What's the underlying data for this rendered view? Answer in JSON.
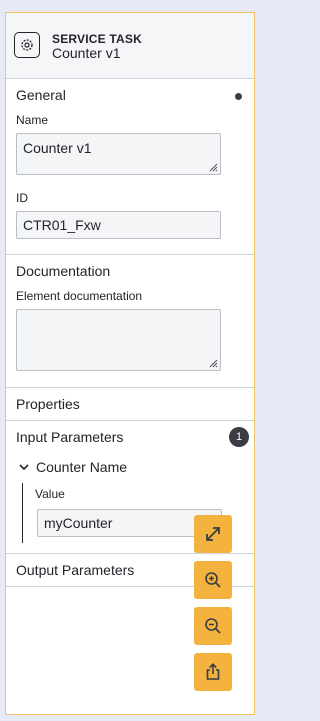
{
  "header": {
    "type": "SERVICE TASK",
    "name": "Counter v1",
    "icon": "gear-icon"
  },
  "general": {
    "title": "General",
    "name_label": "Name",
    "name_value": "Counter v1",
    "id_label": "ID",
    "id_value": "CTR01_Fxw"
  },
  "documentation": {
    "title": "Documentation",
    "label": "Element documentation",
    "value": ""
  },
  "properties": {
    "title": "Properties"
  },
  "input_parameters": {
    "title": "Input Parameters",
    "count": "1",
    "items": [
      {
        "name": "Counter Name",
        "value_label": "Value",
        "value": "myCounter"
      }
    ]
  },
  "output_parameters": {
    "title": "Output Parameters"
  },
  "toolbar": {
    "icons": [
      "expand-icon",
      "zoom-in-icon",
      "zoom-out-icon",
      "share-icon"
    ],
    "accent": "#f4b23e"
  }
}
